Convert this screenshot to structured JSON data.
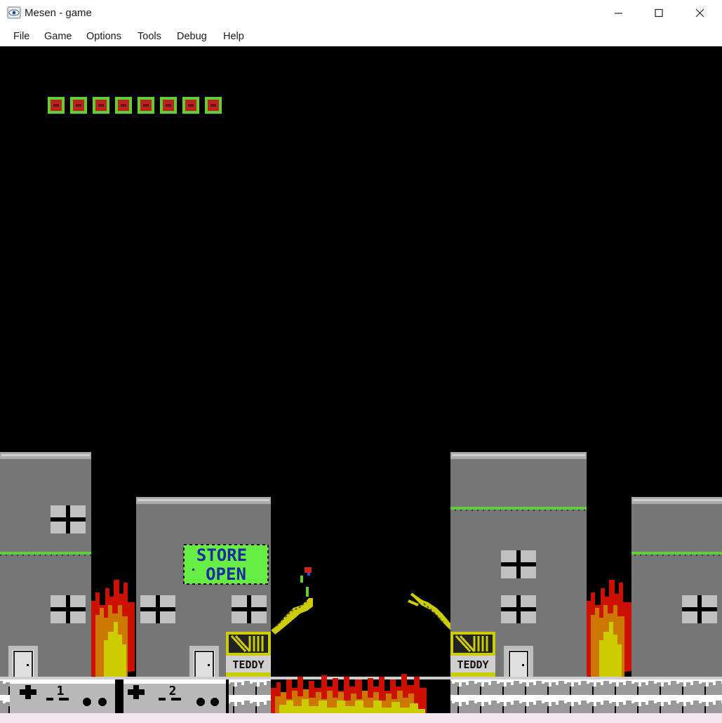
{
  "window": {
    "title": "Mesen - game",
    "icon": "mesen-eye-icon"
  },
  "menu": {
    "items": [
      {
        "label": "File"
      },
      {
        "label": "Game"
      },
      {
        "label": "Options"
      },
      {
        "label": "Tools"
      },
      {
        "label": "Debug"
      },
      {
        "label": "Help"
      }
    ]
  },
  "game": {
    "lives_count": 8,
    "sign": {
      "line1": "STORE",
      "line2": "OPEN"
    },
    "shop_label": "TEDDY",
    "controller_1_number": "1",
    "controller_2_number": "2",
    "colors": {
      "building": "#767676",
      "building_top": "#aaaaaa",
      "grass": "#66cc33",
      "sign_bg": "#66ee44",
      "sign_text": "#1a2aa0",
      "fire_red": "#cc1100",
      "fire_orange": "#cc7700",
      "fire_yellow": "#cccc00",
      "arm": "#cccc00",
      "life_outer": "#66cc33",
      "life_inner": "#bb2222"
    }
  }
}
